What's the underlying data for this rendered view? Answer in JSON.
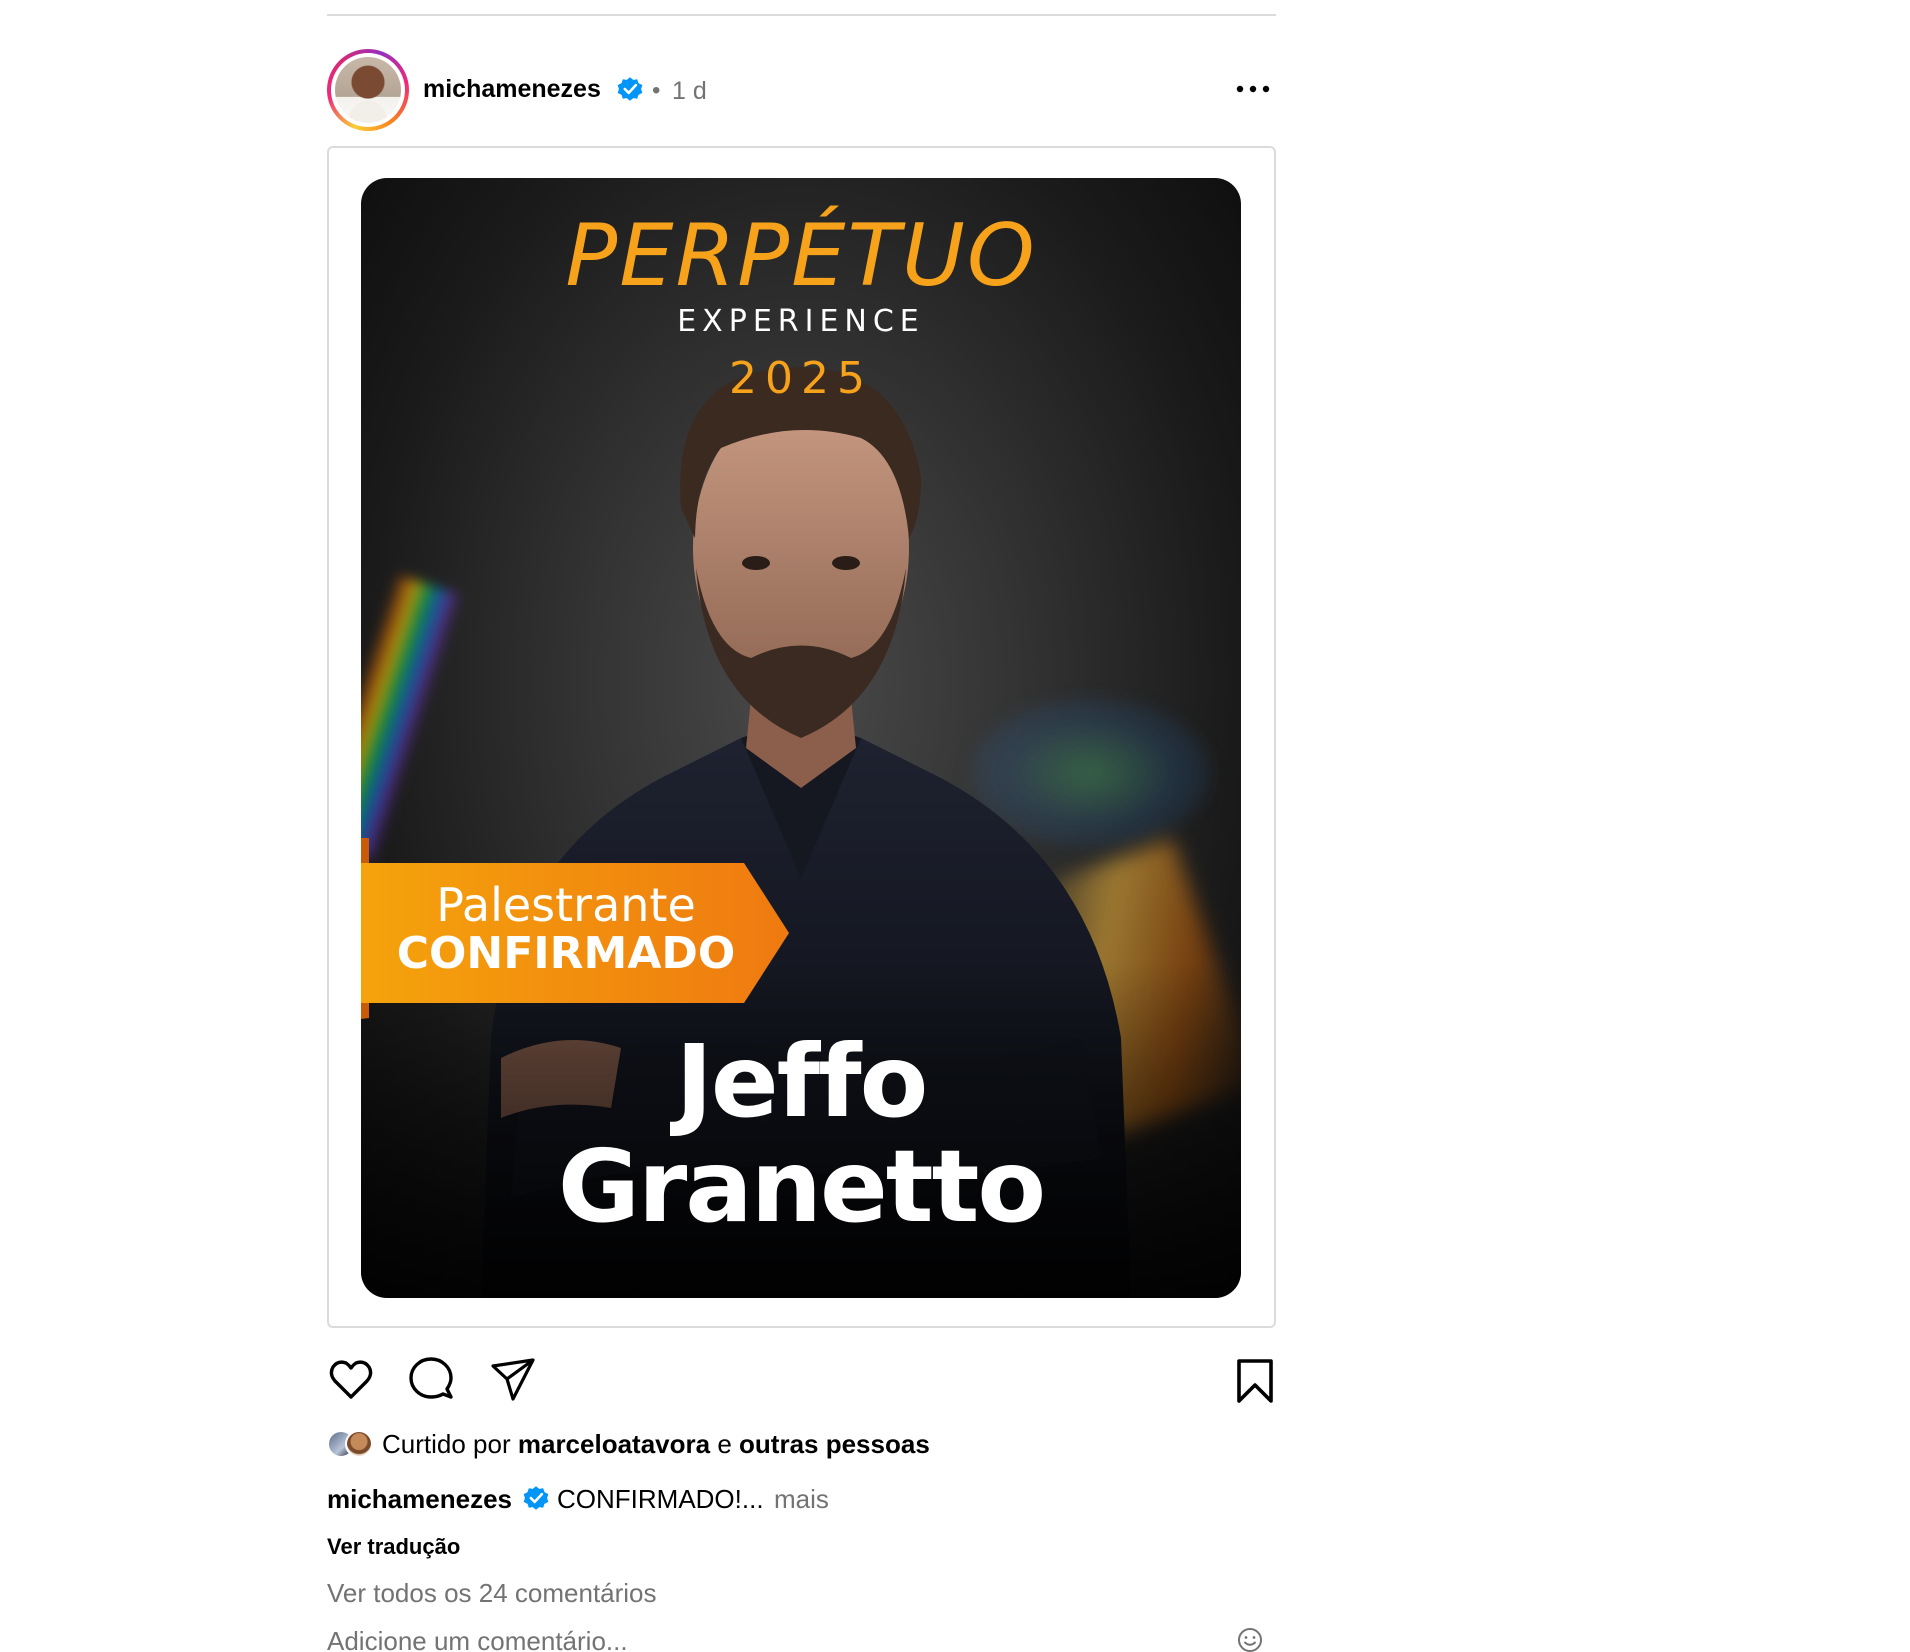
{
  "post": {
    "username": "michamenezes",
    "time_separator": "•",
    "time": "1 d",
    "image": {
      "title": "PERPÉTUO",
      "subtitle": "EXPERIENCE",
      "year": "2025",
      "ribbon_line1": "Palestrante",
      "ribbon_line2": "CONFIRMADO",
      "speaker_first": "Jeffo",
      "speaker_last": "Granetto",
      "accent_color": "#f7a21b"
    },
    "likes": {
      "prefix": "Curtido por",
      "user": "marceloatavora",
      "connector": "e",
      "others": "outras pessoas"
    },
    "caption": {
      "username": "michamenezes",
      "text": "CONFIRMADO!...",
      "more": "mais"
    },
    "translate_label": "Ver tradução",
    "view_comments": "Ver todos os 24 comentários",
    "add_comment_placeholder": "Adicione um comentário..."
  },
  "icons": {
    "more": "more-horizontal-icon",
    "verified": "verified-badge-icon",
    "like": "heart-icon",
    "comment": "comment-icon",
    "share": "paper-plane-icon",
    "save": "bookmark-icon",
    "emoji": "smiley-icon"
  },
  "colors": {
    "verified_blue": "#0095f6",
    "muted_text": "#737373",
    "divider": "#dbdbdb"
  }
}
